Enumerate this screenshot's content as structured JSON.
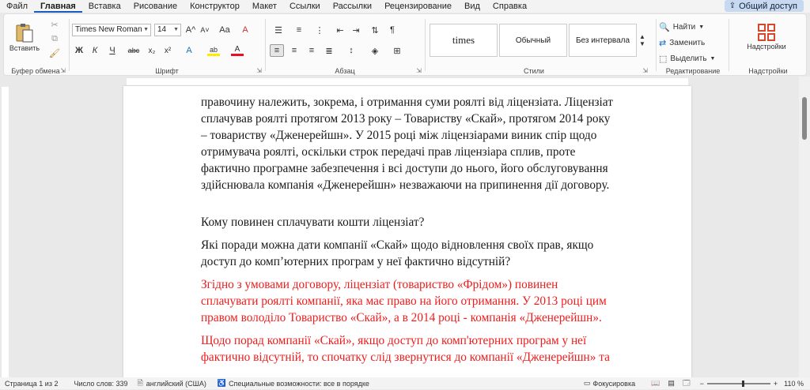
{
  "menu": {
    "tabs": [
      "Файл",
      "Главная",
      "Вставка",
      "Рисование",
      "Конструктор",
      "Макет",
      "Ссылки",
      "Рассылки",
      "Рецензирование",
      "Вид",
      "Справка"
    ],
    "share_label": "Общий доступ"
  },
  "ribbon": {
    "clipboard": {
      "paste_label": "Вставить",
      "group_label": "Буфер обмена"
    },
    "font": {
      "font_name": "Times New Roman",
      "font_size": "14",
      "group_label": "Шрифт",
      "bold": "Ж",
      "italic": "К",
      "underline": "Ч",
      "strike": "abc",
      "sub": "x₂",
      "sup": "x²",
      "grow": "A^",
      "shrink": "A˅",
      "case": "Aa",
      "clear": "A",
      "highlight": "ab",
      "color": "A"
    },
    "paragraph": {
      "group_label": "Абзац",
      "pilcrow": "¶"
    },
    "styles": {
      "items": [
        "times",
        "Обычный",
        "Без интервала"
      ],
      "group_label": "Стили"
    },
    "editing": {
      "find": "Найти",
      "replace": "Заменить",
      "select": "Выделить",
      "group_label": "Редактирование"
    },
    "addins": {
      "label": "Надстройки",
      "group_label": "Надстройки"
    },
    "accent_color": "#185abd",
    "addins_icon_color": "#d9472b"
  },
  "document": {
    "lines_block1": [
      "правочину належить, зокрема, і отримання суми роялті від ліцензіата. Ліцензіат",
      "сплачував роялті протягом 2013 року – Товариству «Скай», протягом 2014 року",
      "– товариству «Дженерейшн». У 2015 році між ліцензіарами виник спір щодо",
      "отримувача роялті, оскільки строк передачі прав ліцензіара сплив, проте",
      "фактично програмне забезпечення і всі доступи до нього, його обслуговування",
      "здійснювала компанія «Дженерейшн» незважаючи на припинення дії договору."
    ],
    "question1": "Кому повинен сплачувати кошти ліцензіат?",
    "question2_lines": [
      "Які поради можна дати компанії «Скай» щодо відновлення своїх прав, якщо",
      "доступ до комп’ютерних програм у неї фактично відсутній?"
    ],
    "answer1_lines": [
      "Згідно з умовами договору, ліцензіат (товариство «Фрідом») повинен",
      "сплачувати роялті компанії, яка має право на його отримання. У 2013 році цим",
      "правом володіло Товариство «Скай», а в 2014 році - компанія «Дженерейшн»."
    ],
    "answer2_lines": [
      "Щодо порад компанії «Скай», якщо доступ до комп'ютерних програм у неї",
      "фактично відсутній, то спочатку слід звернутися до компанії «Дженерейшн» та"
    ],
    "answer_color": "#ee1c1c"
  },
  "status": {
    "page": "Страница 1 из 2",
    "words": "Число слов: 339",
    "language": "английский (США)",
    "accessibility": "Специальные возможности: все в порядке",
    "focus": "Фокусировка",
    "zoom": "110 %"
  }
}
